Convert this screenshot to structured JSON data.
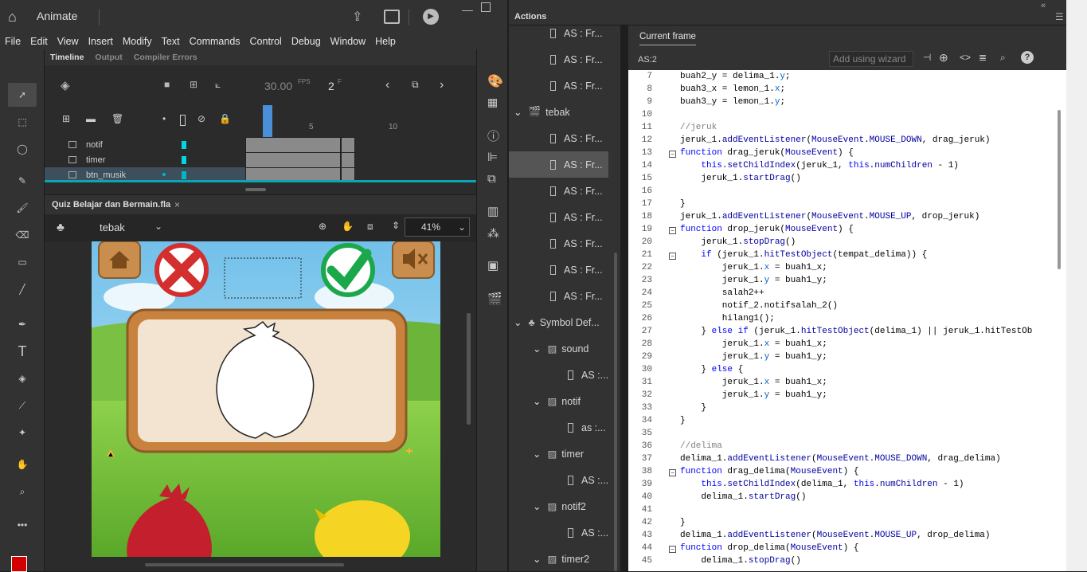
{
  "app": {
    "name": "Animate"
  },
  "menu": [
    "File",
    "Edit",
    "View",
    "Insert",
    "Modify",
    "Text",
    "Commands",
    "Control",
    "Debug",
    "Window",
    "Help"
  ],
  "timeline": {
    "tabs": [
      "Timeline",
      "Output",
      "Compiler Errors"
    ],
    "fps": "30.00",
    "fps_unit": "FPS",
    "frame": "2",
    "frame_unit": "F",
    "ruler": [
      "5",
      "10"
    ],
    "layers": [
      "notif",
      "timer",
      "btn_musik"
    ]
  },
  "stage": {
    "doc_tab": "Quiz Belajar dan Bermain.fla",
    "scene": "tebak",
    "zoom": "41%"
  },
  "actions": {
    "panel_title": "Actions",
    "tab": "Current frame",
    "script_label": "AS:2",
    "wizard_placeholder": "Add using wizard",
    "nav": [
      {
        "label": "AS : Fr..."
      },
      {
        "label": "AS : Fr..."
      },
      {
        "label": "AS : Fr..."
      },
      {
        "label": "tebak"
      },
      {
        "label": "AS : Fr..."
      },
      {
        "label": "AS : Fr..."
      },
      {
        "label": "AS : Fr..."
      },
      {
        "label": "AS : Fr..."
      },
      {
        "label": "AS : Fr..."
      },
      {
        "label": "AS : Fr..."
      },
      {
        "label": "AS : Fr..."
      },
      {
        "label": "Symbol Def..."
      },
      {
        "label": "sound"
      },
      {
        "label": "AS :..."
      },
      {
        "label": "notif"
      },
      {
        "label": "as :..."
      },
      {
        "label": "timer"
      },
      {
        "label": "AS :..."
      },
      {
        "label": "notif2"
      },
      {
        "label": "AS :..."
      },
      {
        "label": "timer2"
      }
    ],
    "code_lines": [
      {
        "n": "7",
        "t": "buah2_y = delima_1.y;"
      },
      {
        "n": "8",
        "t": "buah3_x = lemon_1.x;"
      },
      {
        "n": "9",
        "t": "buah3_y = lemon_1.y;"
      },
      {
        "n": "10",
        "t": ""
      },
      {
        "n": "11",
        "t": "//jeruk"
      },
      {
        "n": "12",
        "t": "jeruk_1.addEventListener(MouseEvent.MOUSE_DOWN, drag_jeruk)"
      },
      {
        "n": "13",
        "t": "function drag_jeruk(MouseEvent) {"
      },
      {
        "n": "14",
        "t": "    this.setChildIndex(jeruk_1, this.numChildren - 1)"
      },
      {
        "n": "15",
        "t": "    jeruk_1.startDrag()"
      },
      {
        "n": "16",
        "t": ""
      },
      {
        "n": "17",
        "t": "}"
      },
      {
        "n": "18",
        "t": "jeruk_1.addEventListener(MouseEvent.MOUSE_UP, drop_jeruk)"
      },
      {
        "n": "19",
        "t": "function drop_jeruk(MouseEvent) {"
      },
      {
        "n": "20",
        "t": "    jeruk_1.stopDrag()"
      },
      {
        "n": "21",
        "t": "    if (jeruk_1.hitTestObject(tempat_delima)) {"
      },
      {
        "n": "22",
        "t": "        jeruk_1.x = buah1_x;"
      },
      {
        "n": "23",
        "t": "        jeruk_1.y = buah1_y;"
      },
      {
        "n": "24",
        "t": "        salah2++"
      },
      {
        "n": "25",
        "t": "        notif_2.notifsalah_2()"
      },
      {
        "n": "26",
        "t": "        hilang1();"
      },
      {
        "n": "27",
        "t": "    } else if (jeruk_1.hitTestObject(delima_1) || jeruk_1.hitTestOb"
      },
      {
        "n": "28",
        "t": "        jeruk_1.x = buah1_x;"
      },
      {
        "n": "29",
        "t": "        jeruk_1.y = buah1_y;"
      },
      {
        "n": "30",
        "t": "    } else {"
      },
      {
        "n": "31",
        "t": "        jeruk_1.x = buah1_x;"
      },
      {
        "n": "32",
        "t": "        jeruk_1.y = buah1_y;"
      },
      {
        "n": "33",
        "t": "    }"
      },
      {
        "n": "34",
        "t": "}"
      },
      {
        "n": "35",
        "t": ""
      },
      {
        "n": "36",
        "t": "//delima"
      },
      {
        "n": "37",
        "t": "delima_1.addEventListener(MouseEvent.MOUSE_DOWN, drag_delima)"
      },
      {
        "n": "38",
        "t": "function drag_delima(MouseEvent) {"
      },
      {
        "n": "39",
        "t": "    this.setChildIndex(delima_1, this.numChildren - 1)"
      },
      {
        "n": "40",
        "t": "    delima_1.startDrag()"
      },
      {
        "n": "41",
        "t": ""
      },
      {
        "n": "42",
        "t": "}"
      },
      {
        "n": "43",
        "t": "delima_1.addEventListener(MouseEvent.MOUSE_UP, drop_delima)"
      },
      {
        "n": "44",
        "t": "function drop_delima(MouseEvent) {"
      },
      {
        "n": "45",
        "t": "    delima_1.stopDrag()"
      }
    ]
  },
  "colors": {
    "accent_blue": "#4a90d9",
    "fill_color": "#d40000",
    "selected_layer": "#00b7c3"
  }
}
